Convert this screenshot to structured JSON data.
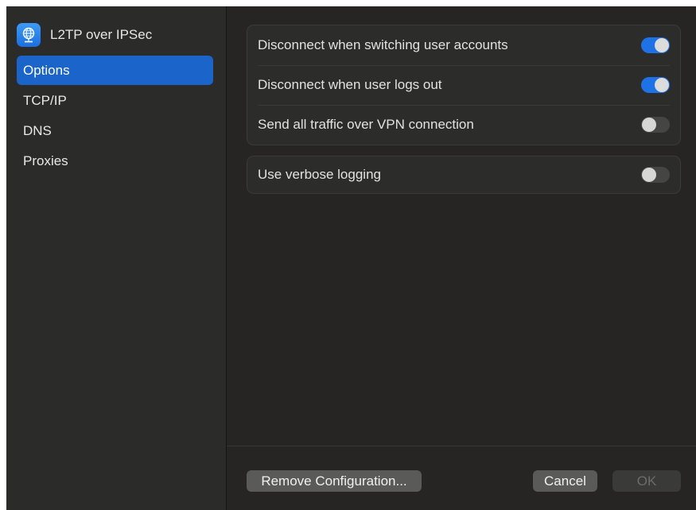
{
  "sidebar": {
    "title": "L2TP over IPSec",
    "icon": "vpn-globe-icon",
    "items": [
      {
        "label": "Options",
        "selected": true
      },
      {
        "label": "TCP/IP",
        "selected": false
      },
      {
        "label": "DNS",
        "selected": false
      },
      {
        "label": "Proxies",
        "selected": false
      }
    ]
  },
  "options": {
    "group1": [
      {
        "label": "Disconnect when switching user accounts",
        "on": true
      },
      {
        "label": "Disconnect when user logs out",
        "on": true
      },
      {
        "label": "Send all traffic over VPN connection",
        "on": false
      }
    ],
    "group2": [
      {
        "label": "Use verbose logging",
        "on": false
      }
    ]
  },
  "footer": {
    "remove_label": "Remove Configuration...",
    "cancel_label": "Cancel",
    "ok_label": "OK"
  },
  "colors": {
    "accent": "#1f72e6",
    "selection": "#1b64c9",
    "background": "#242322"
  }
}
